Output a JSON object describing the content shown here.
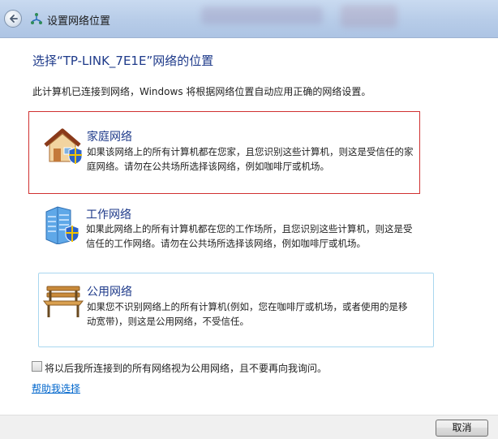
{
  "window": {
    "title": "设置网络位置"
  },
  "heading": "选择“TP-LINK_7E1E”网络的位置",
  "intro": "此计算机已连接到网络，Windows 将根据网络位置自动应用正确的网络设置。",
  "options": [
    {
      "title": "家庭网络",
      "desc1": "如果该网络上的所有计算机都在您家，且您识别这些计算机，则这是受信任的家",
      "desc2": "庭网络。请勿在公共场所选择该网络，例如咖啡厅或机场。",
      "icon": "home-network-icon"
    },
    {
      "title": "工作网络",
      "desc1": "如果此网络上的所有计算机都在您的工作场所，且您识别这些计算机，则这是受",
      "desc2": "信任的工作网络。请勿在公共场所选择该网络，例如咖啡厅或机场。",
      "icon": "work-network-icon"
    },
    {
      "title": "公用网络",
      "desc1": "如果您不识别网络上的所有计算机(例如，您在咖啡厅或机场，或者使用的是移",
      "desc2": "动宽带)，则这是公用网络，不受信任。",
      "icon": "public-network-icon"
    }
  ],
  "checkbox": {
    "label": "将以后我所连接到的所有网络视为公用网络，且不要再向我询问。",
    "checked": false
  },
  "help_link": "帮助我选择",
  "footer": {
    "cancel_label": "取消"
  },
  "colors": {
    "heading": "#1e3a8a",
    "link": "#0066cc",
    "selection_border": "#d03030",
    "hover_border": "#a9d7ef"
  }
}
